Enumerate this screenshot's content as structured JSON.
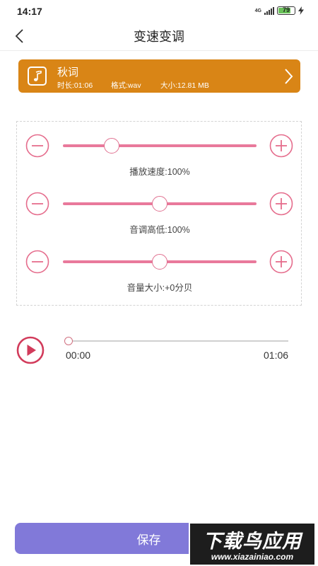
{
  "status_bar": {
    "time": "14:17",
    "network_label": "4G",
    "battery_level": "79",
    "battery_percent": 79
  },
  "header": {
    "title": "变速变调",
    "back_icon": "chevron-left-icon"
  },
  "file": {
    "name": "秋词",
    "duration": "时长:01:06",
    "format": "格式:wav",
    "size": "大小:12.81 MB",
    "icon": "music-note-icon",
    "accent_color": "#d98516"
  },
  "controls": [
    {
      "key": "speed",
      "label": "播放速度:100%",
      "position": 0.25
    },
    {
      "key": "pitch",
      "label": "音调高低:100%",
      "position": 0.5
    },
    {
      "key": "volume",
      "label": "音量大小:+0分贝",
      "position": 0.5
    }
  ],
  "player": {
    "current_time": "00:00",
    "total_time": "01:06",
    "progress": 0.0
  },
  "save": {
    "label": "保存",
    "color": "#8179d9"
  },
  "watermark": {
    "title": "下载鸟应用",
    "url": "www.xiazainiao.com"
  },
  "colors": {
    "slider": "#e9799b",
    "ctrl_icon": "#e56d8d",
    "play": "#d23b5b"
  }
}
